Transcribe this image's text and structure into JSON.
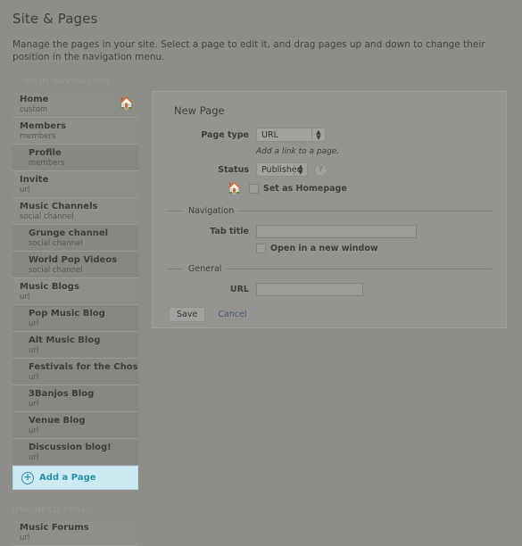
{
  "header": {
    "title": "Site & Pages",
    "description": "Manage the pages in your site. Select a page to edit it, and drag pages up and down to change their position in the navigation menu.",
    "main_nav_label": "MAIN NAVIGATION",
    "unlinked_label": "UNLINKED PAGES"
  },
  "sidebar": {
    "items": [
      {
        "title": "Home",
        "subtitle": "custom",
        "child": false,
        "active": false,
        "home_icon": "home-icon"
      },
      {
        "title": "Members",
        "subtitle": "members",
        "child": false,
        "active": false
      },
      {
        "title": "Profile",
        "subtitle": "members",
        "child": true,
        "active": true
      },
      {
        "title": "Invite",
        "subtitle": "url",
        "child": false,
        "active": false
      },
      {
        "title": "Music Channels",
        "subtitle": "social channel",
        "child": false,
        "active": false
      },
      {
        "title": "Grunge channel",
        "subtitle": "social channel",
        "child": true,
        "active": true
      },
      {
        "title": "World Pop Videos",
        "subtitle": "social channel",
        "child": true,
        "active": true
      },
      {
        "title": "Music Blogs",
        "subtitle": "url",
        "child": false,
        "active": false
      },
      {
        "title": "Pop Music Blog",
        "subtitle": "url",
        "child": true,
        "active": true
      },
      {
        "title": "Alt Music Blog",
        "subtitle": "url",
        "child": true,
        "active": true
      },
      {
        "title": "Festivals for the Chosen",
        "subtitle": "url",
        "child": true,
        "active": true
      },
      {
        "title": "3Banjos Blog",
        "subtitle": "url",
        "child": true,
        "active": true
      },
      {
        "title": "Venue Blog",
        "subtitle": "url",
        "child": true,
        "active": true
      },
      {
        "title": "Discussion blog!",
        "subtitle": "url",
        "child": true,
        "active": true
      }
    ],
    "add_page": {
      "label": "Add a Page",
      "icon": "plus-circle-icon"
    },
    "unlinked_items": [
      {
        "title": "Music Forums",
        "subtitle": "url",
        "child": false,
        "active": false
      }
    ]
  },
  "panel": {
    "title": "New Page",
    "page_type": {
      "label": "Page type",
      "value": "URL",
      "options": [
        "URL"
      ],
      "hint": "Add a link to a page."
    },
    "status": {
      "label": "Status",
      "value": "Published",
      "options": [
        "Published"
      ],
      "help_icon": "question-mark-icon"
    },
    "homepage": {
      "icon": "home-icon",
      "label": "Set as Homepage",
      "checked": false
    },
    "navigation_section": {
      "legend": "Navigation",
      "tab_title": {
        "label": "Tab title",
        "value": "",
        "placeholder": ""
      },
      "new_window": {
        "label": "Open in a new window",
        "checked": false
      }
    },
    "general_section": {
      "legend": "General",
      "url": {
        "label": "URL",
        "value": "",
        "placeholder": ""
      }
    },
    "actions": {
      "save_label": "Save",
      "cancel_label": "Cancel"
    }
  },
  "colors": {
    "page_background": "#8d8d89",
    "panel_background": "#949490",
    "add_page_background": "#cdeaf2",
    "add_page_accent": "#2a8fa8",
    "row_child_background": "#878783"
  }
}
